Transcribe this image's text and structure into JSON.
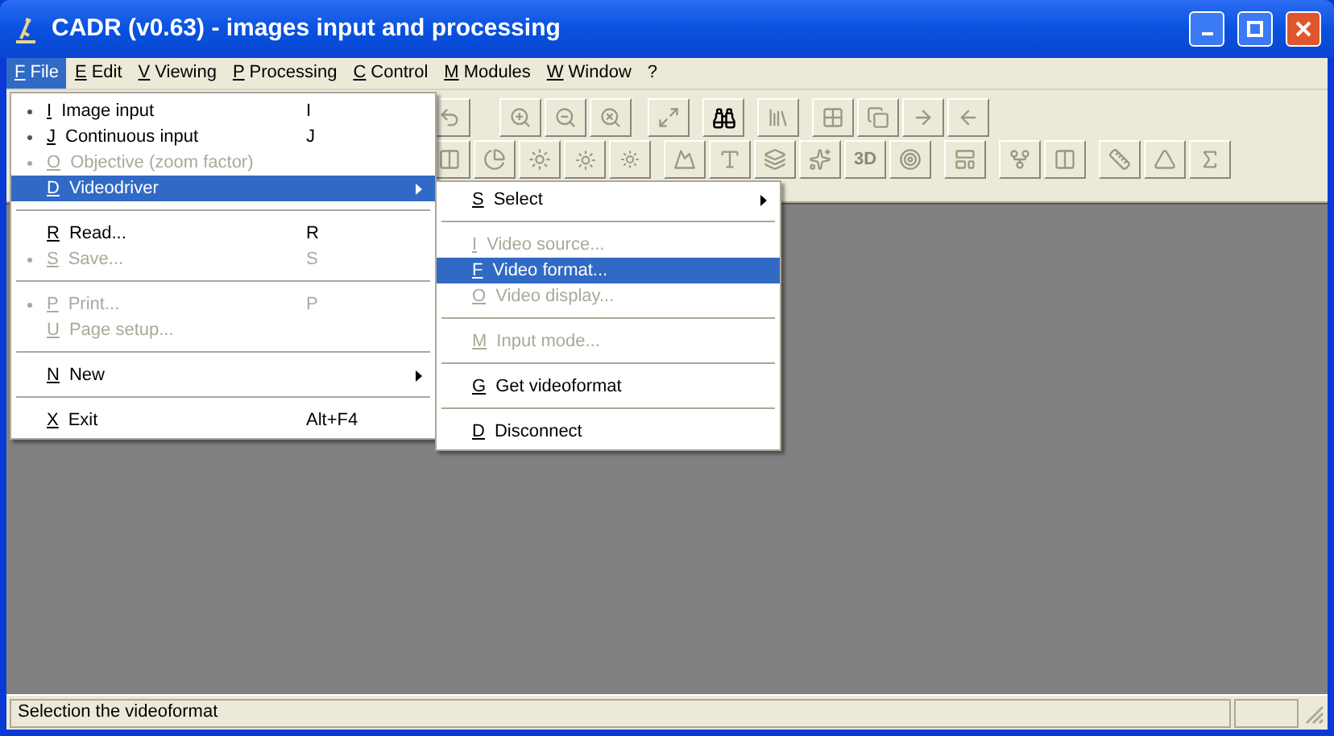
{
  "window": {
    "title": "CADR (v0.63) - images input and processing"
  },
  "menu_bar": [
    {
      "key": "F",
      "label": "File",
      "selected": true
    },
    {
      "key": "E",
      "label": "Edit",
      "selected": false
    },
    {
      "key": "V",
      "label": "Viewing",
      "selected": false
    },
    {
      "key": "P",
      "label": "Processing",
      "selected": false
    },
    {
      "key": "C",
      "label": "Control",
      "selected": false
    },
    {
      "key": "M",
      "label": "Modules",
      "selected": false
    },
    {
      "key": "W",
      "label": "Window",
      "selected": false
    },
    {
      "label": "?",
      "selected": false
    }
  ],
  "toolbar": {
    "button_label": "3D"
  },
  "file_menu": [
    {
      "kind": "item",
      "key": "I",
      "label": "Image input",
      "shortcut": "I",
      "bullet": true,
      "disabled": false,
      "selected": false,
      "submenu": false
    },
    {
      "kind": "item",
      "key": "J",
      "label": "Continuous input",
      "shortcut": "J",
      "bullet": true,
      "disabled": false,
      "selected": false,
      "submenu": false
    },
    {
      "kind": "item",
      "key": "O",
      "label": "Objective (zoom factor)",
      "bullet": true,
      "disabled": true,
      "selected": false,
      "submenu": false
    },
    {
      "kind": "item",
      "key": "D",
      "label": "Videodriver",
      "bullet": false,
      "disabled": false,
      "selected": true,
      "submenu": true
    },
    {
      "kind": "separator"
    },
    {
      "kind": "item",
      "key": "R",
      "label": "Read...",
      "shortcut": "R",
      "bullet": false,
      "disabled": false,
      "selected": false,
      "submenu": false
    },
    {
      "kind": "item",
      "key": "S",
      "label": "Save...",
      "shortcut": "S",
      "bullet": true,
      "disabled": true,
      "selected": false,
      "submenu": false
    },
    {
      "kind": "separator"
    },
    {
      "kind": "item",
      "key": "P",
      "label": "Print...",
      "shortcut": "P",
      "bullet": true,
      "disabled": true,
      "selected": false,
      "submenu": false
    },
    {
      "kind": "item",
      "key": "U",
      "label": "Page setup...",
      "bullet": false,
      "disabled": true,
      "selected": false,
      "submenu": false
    },
    {
      "kind": "separator"
    },
    {
      "kind": "item",
      "key": "N",
      "label": "New",
      "bullet": false,
      "disabled": false,
      "selected": false,
      "submenu": true
    },
    {
      "kind": "separator"
    },
    {
      "kind": "item",
      "key": "X",
      "label": "Exit",
      "shortcut": "Alt+F4",
      "bullet": false,
      "disabled": false,
      "selected": false,
      "submenu": false
    }
  ],
  "videodriver_menu": [
    {
      "kind": "item",
      "key": "S",
      "label": "Select",
      "bullet": false,
      "disabled": false,
      "selected": false,
      "submenu": true
    },
    {
      "kind": "separator"
    },
    {
      "kind": "item",
      "key": "I",
      "label": "Video source...",
      "bullet": false,
      "disabled": true,
      "selected": false,
      "submenu": false
    },
    {
      "kind": "item",
      "key": "F",
      "label": "Video format...",
      "bullet": false,
      "disabled": false,
      "selected": true,
      "submenu": false
    },
    {
      "kind": "item",
      "key": "O",
      "label": "Video display...",
      "bullet": false,
      "disabled": true,
      "selected": false,
      "submenu": false
    },
    {
      "kind": "separator"
    },
    {
      "kind": "item",
      "key": "M",
      "label": "Input mode...",
      "bullet": false,
      "disabled": true,
      "selected": false,
      "submenu": false
    },
    {
      "kind": "separator"
    },
    {
      "kind": "item",
      "key": "G",
      "label": "Get videoformat",
      "bullet": false,
      "disabled": false,
      "selected": false,
      "submenu": false
    },
    {
      "kind": "separator"
    },
    {
      "kind": "item",
      "key": "D",
      "label": "Disconnect",
      "bullet": false,
      "disabled": false,
      "selected": false,
      "submenu": false
    }
  ],
  "status_bar": {
    "text": "Selection the videoformat"
  }
}
